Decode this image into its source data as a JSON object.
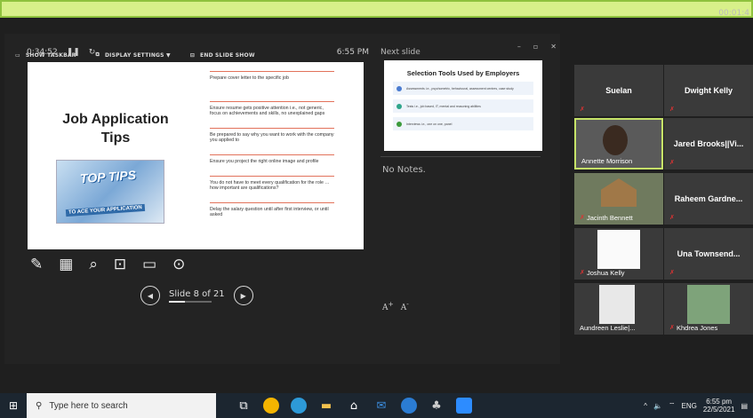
{
  "meeting": {
    "timer": "00:01:4"
  },
  "presenter_view": {
    "toolbar": {
      "show_taskbar": "SHOW TASKBAR",
      "display_settings": "DISPLAY SETTINGS ▼",
      "end_show": "END SLIDE SHOW"
    },
    "elapsed": "0:34:52",
    "clock": "6:55 PM",
    "next_label": "Next slide",
    "notes": "No Notes.",
    "slide_counter": "Slide 8 of 21",
    "slide_progress": 0.38,
    "current_slide": {
      "title_line1": "Job Application",
      "title_line2": "Tips",
      "image_text_top": "TOP TIPS",
      "image_text_bottom": "TO ACE YOUR APPLICATION",
      "bullets": [
        "Prepare cover letter to the specific job",
        "Ensure resume gets positive attention i.e., not generic, focus on achievements and skills, no unexplained gaps",
        "Be prepared to say why you want to work with the company you applied to",
        "Ensure you project the right online image and profile",
        "You do not have to meet every qualification for the role … how important are qualifications?",
        "Delay the salary question until after first interview, or until asked"
      ]
    },
    "next_slide": {
      "title": "Selection Tools Used by Employers",
      "rows": [
        "Assessments i.e., psychometric, behavioural, assessment centres, case study",
        "Tests i.e., job based, IT, mental and reasoning abilities",
        "Interviews i.e., one on one, panel"
      ]
    }
  },
  "participants": [
    {
      "name": "Suelan",
      "type": "name",
      "muted": true
    },
    {
      "name": "Dwight Kelly",
      "type": "name",
      "muted": true
    },
    {
      "name": "Annette Morrison",
      "type": "video",
      "muted": false,
      "active": true
    },
    {
      "name": "Jared Brooks||Vi...",
      "type": "name",
      "muted": true
    },
    {
      "name": "Jacinth Bennett",
      "type": "video",
      "muted": true
    },
    {
      "name": "Raheem  Gardne...",
      "type": "name",
      "muted": true
    },
    {
      "name": "Joshua Kelly",
      "type": "video",
      "muted": true
    },
    {
      "name": "Una  Townsend...",
      "type": "name",
      "muted": true
    },
    {
      "name": "Aundreen Leslie|...",
      "type": "video",
      "muted": false
    },
    {
      "name": "Khdrea Jones",
      "type": "video",
      "muted": true
    }
  ],
  "taskbar": {
    "search_placeholder": "Type here to search",
    "lang": "ENG",
    "time": "6:55 pm",
    "date": "22/5/2021"
  },
  "colors": {
    "share_border": "#8fc23e",
    "share_bg": "#d8f08a",
    "active_speaker": "#c6e368",
    "accent_rule": "#e2725b"
  }
}
